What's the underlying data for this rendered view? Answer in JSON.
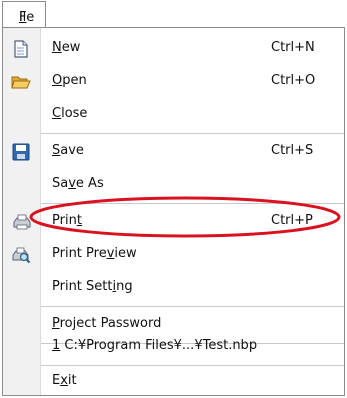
{
  "menubar": {
    "title_underline": "F",
    "title_rest": "ile"
  },
  "items": [
    {
      "name": "new",
      "pre": "",
      "u": "N",
      "post": "ew",
      "shortcut": "Ctrl+N",
      "icon": "new-document-icon"
    },
    {
      "name": "open",
      "pre": "",
      "u": "O",
      "post": "pen",
      "shortcut": "Ctrl+O",
      "icon": "open-folder-icon"
    },
    {
      "name": "close",
      "pre": "",
      "u": "C",
      "post": "lose",
      "shortcut": "",
      "icon": ""
    },
    {
      "name": "save",
      "pre": "",
      "u": "S",
      "post": "ave",
      "shortcut": "Ctrl+S",
      "icon": "floppy-disk-icon"
    },
    {
      "name": "save-as",
      "pre": "Sa",
      "u": "v",
      "post": "e As",
      "shortcut": "",
      "icon": ""
    },
    {
      "name": "print",
      "pre": "Prin",
      "u": "t",
      "post": "",
      "shortcut": "Ctrl+P",
      "icon": "printer-icon"
    },
    {
      "name": "print-preview",
      "pre": "Print Pre",
      "u": "v",
      "post": "iew",
      "shortcut": "",
      "icon": "print-preview-icon"
    },
    {
      "name": "print-setting",
      "pre": "Print Sett",
      "u": "i",
      "post": "ng",
      "shortcut": "",
      "icon": ""
    },
    {
      "name": "project-password",
      "pre": "",
      "u": "P",
      "post": "roject Password",
      "shortcut": "",
      "icon": ""
    },
    {
      "name": "recent-file-1",
      "pre": "",
      "u": "1",
      "post": " C:¥Program Files¥...¥Test.nbp",
      "shortcut": "",
      "icon": ""
    },
    {
      "name": "exit",
      "pre": "E",
      "u": "x",
      "post": "it",
      "shortcut": "",
      "icon": ""
    }
  ],
  "annotation": {
    "highlighted_item": "Print",
    "color": "#d9121f"
  },
  "colors": {
    "gutter": "#f1f1f1",
    "border": "#8c8c8c",
    "separator": "#c9c9c9"
  }
}
